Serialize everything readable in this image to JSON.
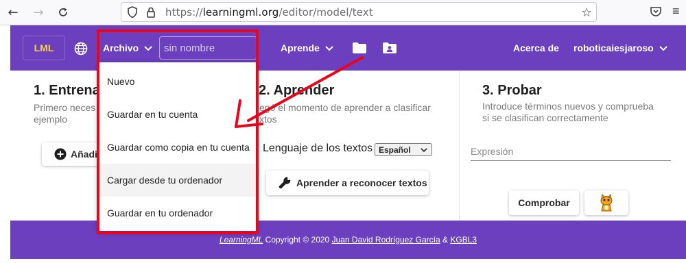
{
  "browser": {
    "url_prefix": "https://",
    "url_domain": "learningml.org",
    "url_path": "/editor/model/text"
  },
  "header": {
    "logo": "LML",
    "archivo": "Archivo",
    "model_name_placeholder": "sin nombre",
    "aprende": "Aprende",
    "acerca": "Acerca de",
    "user": "roboticaiesjaroso"
  },
  "menu": {
    "items": [
      "Nuevo",
      "Guardar en tu cuenta",
      "Guardar como copia en tu cuenta",
      "Cargar desde tu ordenador",
      "Guardar en tu ordenador"
    ]
  },
  "col1": {
    "title": "1. Entrena",
    "desc": "Primero neces",
    "desc2": "ejemplo",
    "add_button": "Añadi"
  },
  "col2": {
    "title": "2. Aprender",
    "desc": "egó el momento de aprender a clasificar",
    "desc2": "xtos",
    "lang_label": "Lenguaje de los textos",
    "lang_value": "Español",
    "learn_button": "Aprender a reconocer textos"
  },
  "col3": {
    "title": "3. Probar",
    "desc": "Introduce términos nuevos y comprueba",
    "desc2": "si se clasifican correctamente",
    "expr_placeholder": "Expresión",
    "check_button": "Comprobar"
  },
  "footer": {
    "brand": "LearningML",
    "copyright": "Copyright © 2020",
    "author": "Juan David Rodríguez García",
    "amp": "&",
    "org": "KGBL3"
  },
  "colors": {
    "brand_purple": "#6c3fbf",
    "logo_yellow": "#f6d34a",
    "annotation_red": "#e8061c"
  }
}
